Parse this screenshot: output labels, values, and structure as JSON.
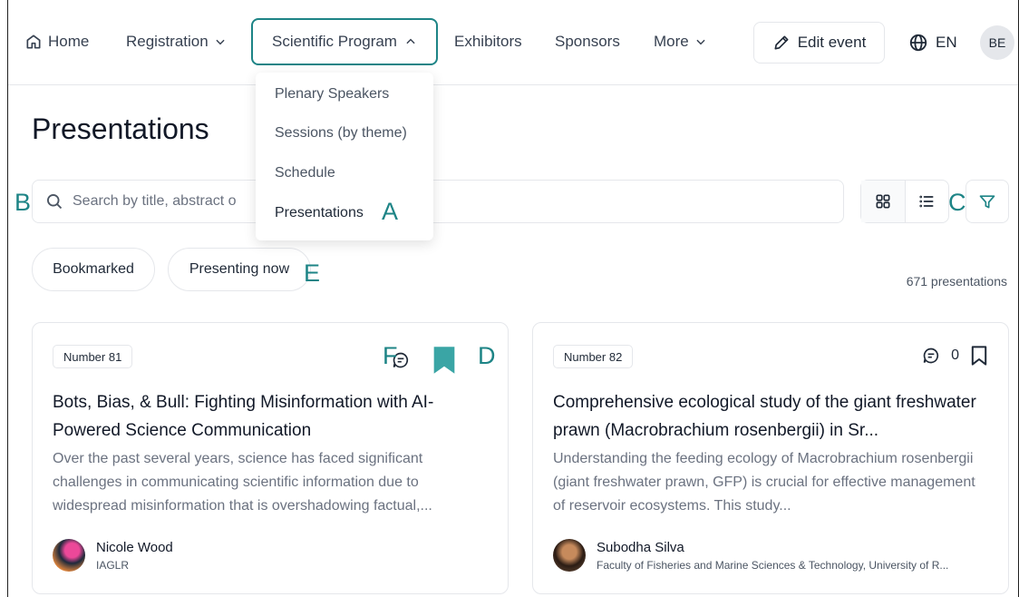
{
  "nav": {
    "home": "Home",
    "registration": "Registration",
    "scientific_program": "Scientific Program",
    "exhibitors": "Exhibitors",
    "sponsors": "Sponsors",
    "more": "More",
    "edit_event": "Edit event",
    "language": "EN",
    "user_initials": "BE"
  },
  "dropdown": {
    "items": [
      "Plenary Speakers",
      "Sessions (by theme)",
      "Schedule",
      "Presentations"
    ]
  },
  "page": {
    "title": "Presentations",
    "search_placeholder": "Search by title, abstract o",
    "filters": [
      "Bookmarked",
      "Presenting now"
    ],
    "count": "671 presentations"
  },
  "cards": [
    {
      "number": "Number 81",
      "title": "Bots, Bias, & Bull: Fighting Misinformation with AI-Powered Science Communication",
      "abstract": "Over the past several years, science has faced significant challenges in communicating scientific information due to widespread misinformation that is overshadowing factual,...",
      "author": "Nicole Wood",
      "affiliation": "IAGLR",
      "comments": "",
      "bookmarked": true
    },
    {
      "number": "Number 82",
      "title": "Comprehensive ecological study of the giant freshwater prawn (Macrobrachium rosenbergii) in Sr...",
      "abstract": "Understanding the feeding ecology of Macrobrachium rosenbergii (giant freshwater prawn, GFP) is crucial for effective management of reservoir ecosystems. This study...",
      "author": "Subodha Silva",
      "affiliation": "Faculty of Fisheries and Marine Sciences & Technology, University of R...",
      "comments": "0",
      "bookmarked": false
    }
  ],
  "annotations": [
    "A",
    "B",
    "C",
    "D",
    "E",
    "F"
  ],
  "colors": {
    "accent": "#1d8486",
    "bookmark": "#3aa5a5"
  }
}
